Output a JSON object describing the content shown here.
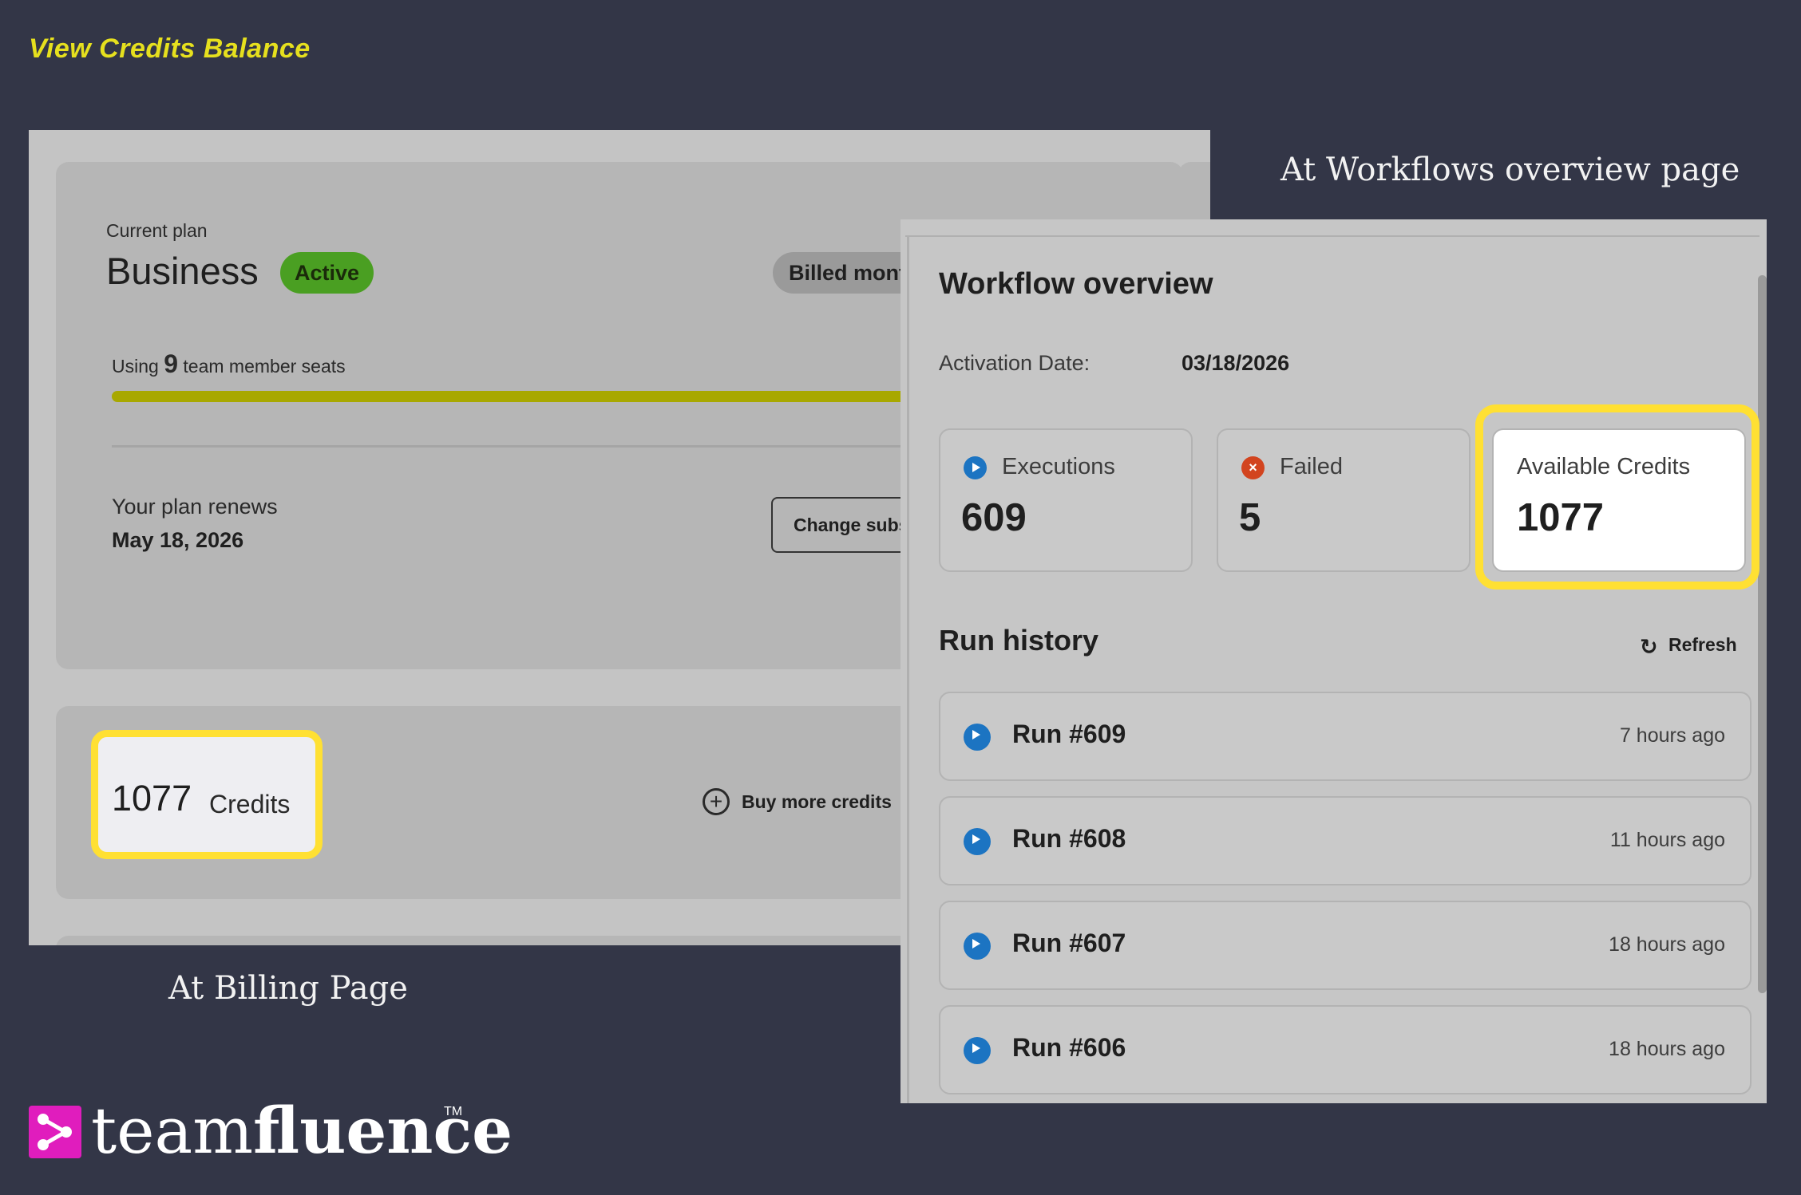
{
  "heading": "View  Credits Balance",
  "captions": {
    "workflow": "At Workflows overview page",
    "billing": "At Billing Page"
  },
  "billing": {
    "plan_label": "Current plan",
    "plan_name": "Business",
    "status": "Active",
    "billing_cycle": "Billed mont",
    "seats_prefix": "Using",
    "seats_count": "9",
    "seats_suffix": "team member seats",
    "renew_label": "Your plan renews",
    "renew_date": "May 18, 2026",
    "change_subscription": "Change subs",
    "credits_amount": "1077",
    "credits_unit": "Credits",
    "buy_more": "Buy more credits"
  },
  "workflow": {
    "title": "Workflow overview",
    "activation_label": "Activation Date:",
    "activation_date": "03/18/2026",
    "stats": [
      {
        "label": "Executions",
        "value": "609",
        "icon": "play-icon"
      },
      {
        "label": "Failed",
        "value": "5",
        "icon": "failed-icon"
      },
      {
        "label": "Available Credits",
        "value": "1077"
      }
    ],
    "run_history_title": "Run history",
    "refresh_label": "Refresh",
    "runs": [
      {
        "name": "Run #609",
        "time": "7 hours ago"
      },
      {
        "name": "Run #608",
        "time": "11 hours ago"
      },
      {
        "name": "Run #607",
        "time": "18 hours ago"
      },
      {
        "name": "Run #606",
        "time": "18 hours ago"
      }
    ]
  },
  "logo": {
    "light": "team",
    "bold": "fluence",
    "tm": "TM"
  },
  "colors": {
    "background": "#333647",
    "heading": "#e6e01e",
    "highlight": "#ffe033",
    "active_badge": "#4a9f22",
    "play_icon": "#1c74c2",
    "failed_icon": "#d2441f",
    "logo_mark": "#e01dbd"
  }
}
